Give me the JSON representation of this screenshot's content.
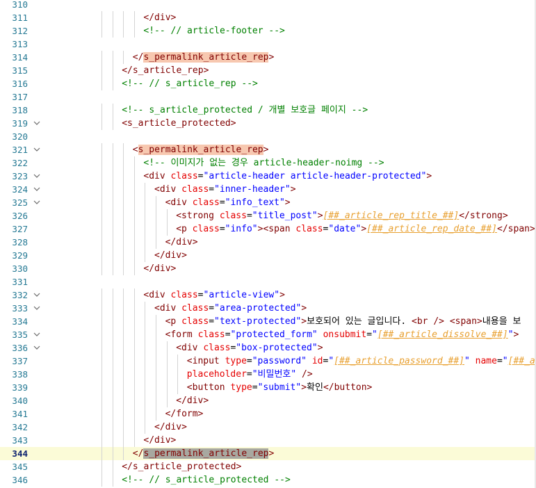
{
  "editor": {
    "current_line": 344,
    "lines": [
      {
        "n": 310,
        "indent": 0,
        "fold": false,
        "tokens": []
      },
      {
        "n": 311,
        "indent": 9,
        "fold": false,
        "tokens": [
          {
            "t": "</div>",
            "c": "tag"
          }
        ]
      },
      {
        "n": 312,
        "indent": 9,
        "fold": false,
        "tokens": [
          {
            "t": "<!-- // article-footer -->",
            "c": "cmt"
          }
        ]
      },
      {
        "n": 313,
        "indent": 0,
        "fold": false,
        "tokens": []
      },
      {
        "n": 314,
        "indent": 8,
        "fold": false,
        "tokens": [
          {
            "t": "</",
            "c": "tag"
          },
          {
            "t": "s_permalink_article_rep",
            "c": "hl"
          },
          {
            "t": ">",
            "c": "tag"
          }
        ]
      },
      {
        "n": 315,
        "indent": 7,
        "fold": false,
        "tokens": [
          {
            "t": "</s_article_rep>",
            "c": "tag"
          }
        ]
      },
      {
        "n": 316,
        "indent": 7,
        "fold": false,
        "tokens": [
          {
            "t": "<!-- // s_article_rep -->",
            "c": "cmt"
          }
        ]
      },
      {
        "n": 317,
        "indent": 0,
        "fold": false,
        "tokens": []
      },
      {
        "n": 318,
        "indent": 7,
        "fold": false,
        "tokens": [
          {
            "t": "<!-- s_article_protected / 개별 보호글 페이지 -->",
            "c": "cmt"
          }
        ]
      },
      {
        "n": 319,
        "indent": 7,
        "fold": true,
        "tokens": [
          {
            "t": "<s_article_protected>",
            "c": "tag"
          }
        ]
      },
      {
        "n": 320,
        "indent": 0,
        "fold": false,
        "tokens": []
      },
      {
        "n": 321,
        "indent": 8,
        "fold": true,
        "tokens": [
          {
            "t": "<",
            "c": "tag"
          },
          {
            "t": "s_permalink_article_rep",
            "c": "hl"
          },
          {
            "t": ">",
            "c": "tag"
          }
        ]
      },
      {
        "n": 322,
        "indent": 9,
        "fold": false,
        "tokens": [
          {
            "t": "<!-- 이미지가 없는 경우 article-header-noimg -->",
            "c": "cmt"
          }
        ]
      },
      {
        "n": 323,
        "indent": 9,
        "fold": true,
        "tokens": [
          {
            "t": "<div ",
            "c": "tag"
          },
          {
            "t": "class",
            "c": "attr"
          },
          {
            "t": "=",
            "c": "text"
          },
          {
            "t": "\"article-header article-header-protected\"",
            "c": "str"
          },
          {
            "t": ">",
            "c": "tag"
          }
        ]
      },
      {
        "n": 324,
        "indent": 10,
        "fold": true,
        "tokens": [
          {
            "t": "<div ",
            "c": "tag"
          },
          {
            "t": "class",
            "c": "attr"
          },
          {
            "t": "=",
            "c": "text"
          },
          {
            "t": "\"inner-header\"",
            "c": "str"
          },
          {
            "t": ">",
            "c": "tag"
          }
        ]
      },
      {
        "n": 325,
        "indent": 11,
        "fold": true,
        "tokens": [
          {
            "t": "<div ",
            "c": "tag"
          },
          {
            "t": "class",
            "c": "attr"
          },
          {
            "t": "=",
            "c": "text"
          },
          {
            "t": "\"info_text\"",
            "c": "str"
          },
          {
            "t": ">",
            "c": "tag"
          }
        ]
      },
      {
        "n": 326,
        "indent": 12,
        "fold": false,
        "tokens": [
          {
            "t": "<strong ",
            "c": "tag"
          },
          {
            "t": "class",
            "c": "attr"
          },
          {
            "t": "=",
            "c": "text"
          },
          {
            "t": "\"title_post\"",
            "c": "str"
          },
          {
            "t": ">",
            "c": "tag"
          },
          {
            "t": "[##_article_rep_title_##]",
            "c": "tpl"
          },
          {
            "t": "</strong>",
            "c": "tag"
          }
        ]
      },
      {
        "n": 327,
        "indent": 12,
        "fold": false,
        "tokens": [
          {
            "t": "<p ",
            "c": "tag"
          },
          {
            "t": "class",
            "c": "attr"
          },
          {
            "t": "=",
            "c": "text"
          },
          {
            "t": "\"info\"",
            "c": "str"
          },
          {
            "t": ">",
            "c": "tag"
          },
          {
            "t": "<span ",
            "c": "tag"
          },
          {
            "t": "class",
            "c": "attr"
          },
          {
            "t": "=",
            "c": "text"
          },
          {
            "t": "\"date\"",
            "c": "str"
          },
          {
            "t": ">",
            "c": "tag"
          },
          {
            "t": "[##_article_rep_date_##]",
            "c": "tpl"
          },
          {
            "t": "</span>",
            "c": "tag"
          },
          {
            "t": " ·",
            "c": "text"
          }
        ]
      },
      {
        "n": 328,
        "indent": 11,
        "fold": false,
        "tokens": [
          {
            "t": "</div>",
            "c": "tag"
          }
        ]
      },
      {
        "n": 329,
        "indent": 10,
        "fold": false,
        "tokens": [
          {
            "t": "</div>",
            "c": "tag"
          }
        ]
      },
      {
        "n": 330,
        "indent": 9,
        "fold": false,
        "tokens": [
          {
            "t": "</div>",
            "c": "tag"
          }
        ]
      },
      {
        "n": 331,
        "indent": 0,
        "fold": false,
        "tokens": []
      },
      {
        "n": 332,
        "indent": 9,
        "fold": true,
        "tokens": [
          {
            "t": "<div ",
            "c": "tag"
          },
          {
            "t": "class",
            "c": "attr"
          },
          {
            "t": "=",
            "c": "text"
          },
          {
            "t": "\"article-view\"",
            "c": "str"
          },
          {
            "t": ">",
            "c": "tag"
          }
        ]
      },
      {
        "n": 333,
        "indent": 10,
        "fold": true,
        "tokens": [
          {
            "t": "<div ",
            "c": "tag"
          },
          {
            "t": "class",
            "c": "attr"
          },
          {
            "t": "=",
            "c": "text"
          },
          {
            "t": "\"area-protected\"",
            "c": "str"
          },
          {
            "t": ">",
            "c": "tag"
          }
        ]
      },
      {
        "n": 334,
        "indent": 11,
        "fold": false,
        "tokens": [
          {
            "t": "<p ",
            "c": "tag"
          },
          {
            "t": "class",
            "c": "attr"
          },
          {
            "t": "=",
            "c": "text"
          },
          {
            "t": "\"text-protected\"",
            "c": "str"
          },
          {
            "t": ">",
            "c": "tag"
          },
          {
            "t": "보호되어 있는 글입니다. ",
            "c": "text"
          },
          {
            "t": "<br />",
            "c": "tag"
          },
          {
            "t": " ",
            "c": "text"
          },
          {
            "t": "<span>",
            "c": "tag"
          },
          {
            "t": "내용을 보",
            "c": "text"
          }
        ]
      },
      {
        "n": 335,
        "indent": 11,
        "fold": true,
        "tokens": [
          {
            "t": "<form ",
            "c": "tag"
          },
          {
            "t": "class",
            "c": "attr"
          },
          {
            "t": "=",
            "c": "text"
          },
          {
            "t": "\"protected_form\"",
            "c": "str"
          },
          {
            "t": " ",
            "c": "text"
          },
          {
            "t": "onsubmit",
            "c": "attr"
          },
          {
            "t": "=",
            "c": "text"
          },
          {
            "t": "\"",
            "c": "str"
          },
          {
            "t": "[##_article_dissolve_##]",
            "c": "tpl"
          },
          {
            "t": "\"",
            "c": "str"
          },
          {
            "t": ">",
            "c": "tag"
          }
        ]
      },
      {
        "n": 336,
        "indent": 12,
        "fold": true,
        "tokens": [
          {
            "t": "<div ",
            "c": "tag"
          },
          {
            "t": "class",
            "c": "attr"
          },
          {
            "t": "=",
            "c": "text"
          },
          {
            "t": "\"box-protected\"",
            "c": "str"
          },
          {
            "t": ">",
            "c": "tag"
          }
        ]
      },
      {
        "n": 337,
        "indent": 13,
        "fold": false,
        "tokens": [
          {
            "t": "<input ",
            "c": "tag"
          },
          {
            "t": "type",
            "c": "attr"
          },
          {
            "t": "=",
            "c": "text"
          },
          {
            "t": "\"password\"",
            "c": "str"
          },
          {
            "t": " ",
            "c": "text"
          },
          {
            "t": "id",
            "c": "attr"
          },
          {
            "t": "=",
            "c": "text"
          },
          {
            "t": "\"",
            "c": "str"
          },
          {
            "t": "[##_article_password_##]",
            "c": "tpl"
          },
          {
            "t": "\"",
            "c": "str"
          },
          {
            "t": " ",
            "c": "text"
          },
          {
            "t": "name",
            "c": "attr"
          },
          {
            "t": "=",
            "c": "text"
          },
          {
            "t": "\"",
            "c": "str"
          },
          {
            "t": "[##_art",
            "c": "tpl"
          }
        ]
      },
      {
        "n": 338,
        "indent": 13,
        "fold": false,
        "tokens": [
          {
            "t": "placeholder",
            "c": "attr"
          },
          {
            "t": "=",
            "c": "text"
          },
          {
            "t": "\"비밀번호\"",
            "c": "str"
          },
          {
            "t": " />",
            "c": "tag"
          }
        ]
      },
      {
        "n": 339,
        "indent": 13,
        "fold": false,
        "tokens": [
          {
            "t": "<button ",
            "c": "tag"
          },
          {
            "t": "type",
            "c": "attr"
          },
          {
            "t": "=",
            "c": "text"
          },
          {
            "t": "\"submit\"",
            "c": "str"
          },
          {
            "t": ">",
            "c": "tag"
          },
          {
            "t": "확인",
            "c": "text"
          },
          {
            "t": "</button>",
            "c": "tag"
          }
        ]
      },
      {
        "n": 340,
        "indent": 12,
        "fold": false,
        "tokens": [
          {
            "t": "</div>",
            "c": "tag"
          }
        ]
      },
      {
        "n": 341,
        "indent": 11,
        "fold": false,
        "tokens": [
          {
            "t": "</form>",
            "c": "tag"
          }
        ]
      },
      {
        "n": 342,
        "indent": 10,
        "fold": false,
        "tokens": [
          {
            "t": "</div>",
            "c": "tag"
          }
        ]
      },
      {
        "n": 343,
        "indent": 9,
        "fold": false,
        "tokens": [
          {
            "t": "</div>",
            "c": "tag"
          }
        ]
      },
      {
        "n": 344,
        "indent": 8,
        "fold": false,
        "tokens": [
          {
            "t": "</",
            "c": "tag"
          },
          {
            "t": "s_permalink_article_rep",
            "c": "hlsel"
          },
          {
            "t": ">",
            "c": "tag"
          }
        ]
      },
      {
        "n": 345,
        "indent": 7,
        "fold": false,
        "tokens": [
          {
            "t": "</s_article_protected>",
            "c": "tag"
          }
        ]
      },
      {
        "n": 346,
        "indent": 7,
        "fold": false,
        "tokens": [
          {
            "t": "<!-- // s_article_protected -->",
            "c": "cmt"
          }
        ]
      }
    ]
  },
  "icons": {
    "fold": "chevron-down-icon"
  },
  "colors": {
    "line_number": "#237893",
    "tag": "#800000",
    "attribute": "#e50000",
    "string": "#0000ff",
    "comment": "#008000",
    "template": "#e8a030",
    "match_highlight": "#f7c8b0",
    "current_line": "#fbfbd7"
  }
}
